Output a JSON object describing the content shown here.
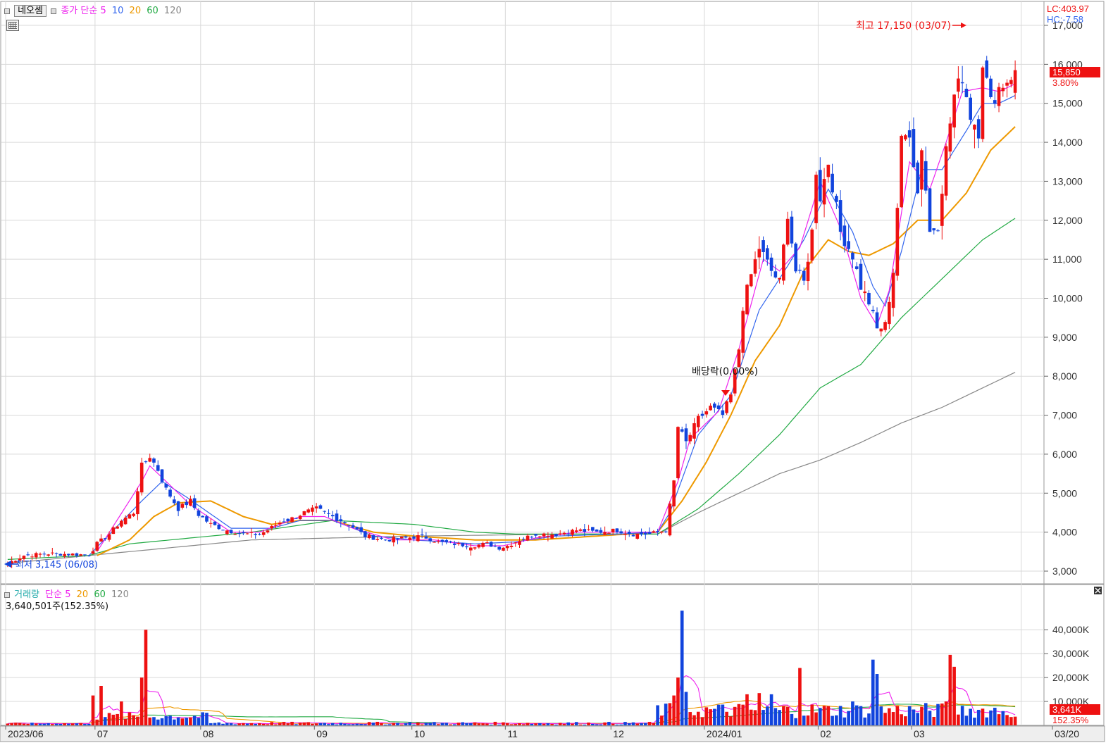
{
  "price_header": {
    "symbol": "네오셈",
    "type_label": "종가 단순",
    "ma_periods": [
      "5",
      "10",
      "20",
      "60",
      "120"
    ],
    "lc": "LC:403.97",
    "hc": "HC:-7.58"
  },
  "volume_header": {
    "label": "거래량",
    "type_label": "단순",
    "ma_periods": [
      "5",
      "20",
      "60",
      "120"
    ],
    "current": "3,640,501주(152.35%)"
  },
  "annotations": {
    "high": "최고 17,150 (03/07)",
    "low": "최저 3,145 (06/08)",
    "dividend": "배당락(0.00%)"
  },
  "last_price": {
    "value": "15,850",
    "change": "3.80%"
  },
  "last_volume": {
    "value": "3,641K",
    "ratio": "152.35%"
  },
  "colors": {
    "up": "#ee1111",
    "down": "#1144dd",
    "ma5": "#ee22ee",
    "ma10": "#3366ee",
    "ma20": "#ee9900",
    "ma60": "#22aa44",
    "ma120": "#888888",
    "grid": "#d9d9d9"
  },
  "chart_data": [
    {
      "type": "candlestick",
      "title": "네오셈",
      "y_ticks": [
        "3,000",
        "4,000",
        "5,000",
        "6,000",
        "7,000",
        "8,000",
        "9,000",
        "10,000",
        "11,000",
        "12,000",
        "13,000",
        "14,000",
        "15,000",
        "16,000",
        "17,000"
      ],
      "ylim": [
        2700,
        17400
      ],
      "x_ticks": [
        "2023/06",
        "07",
        "08",
        "09",
        "10",
        "11",
        "12",
        "2024/01",
        "02",
        "03",
        "03/20"
      ],
      "x_tick_bar_index": [
        0,
        22,
        48,
        76,
        100,
        123,
        149,
        172,
        200,
        223,
        250
      ],
      "anchors": [
        [
          0,
          3200
        ],
        [
          4,
          3400
        ],
        [
          10,
          3450
        ],
        [
          20,
          3420
        ],
        [
          22,
          3700
        ],
        [
          25,
          3950
        ],
        [
          28,
          4300
        ],
        [
          31,
          4500
        ],
        [
          33,
          5700
        ],
        [
          35,
          5950
        ],
        [
          37,
          5600
        ],
        [
          39,
          5100
        ],
        [
          42,
          4600
        ],
        [
          45,
          4800
        ],
        [
          47,
          4450
        ],
        [
          50,
          4200
        ],
        [
          54,
          4050
        ],
        [
          58,
          3950
        ],
        [
          62,
          3950
        ],
        [
          64,
          4050
        ],
        [
          67,
          4250
        ],
        [
          70,
          4350
        ],
        [
          73,
          4500
        ],
        [
          76,
          4600
        ],
        [
          80,
          4400
        ],
        [
          84,
          4200
        ],
        [
          88,
          3900
        ],
        [
          93,
          3800
        ],
        [
          98,
          3850
        ],
        [
          102,
          3900
        ],
        [
          106,
          3750
        ],
        [
          110,
          3700
        ],
        [
          114,
          3650
        ],
        [
          118,
          3700
        ],
        [
          121,
          3600
        ],
        [
          123,
          3650
        ],
        [
          126,
          3800
        ],
        [
          130,
          3950
        ],
        [
          135,
          3950
        ],
        [
          140,
          4050
        ],
        [
          145,
          4000
        ],
        [
          150,
          4050
        ],
        [
          154,
          3950
        ],
        [
          158,
          3950
        ],
        [
          162,
          4050
        ],
        [
          164,
          5300
        ],
        [
          165,
          6700
        ],
        [
          167,
          6300
        ],
        [
          170,
          6900
        ],
        [
          173,
          7200
        ],
        [
          176,
          7000
        ],
        [
          178,
          7500
        ],
        [
          180,
          8700
        ],
        [
          181,
          9800
        ],
        [
          183,
          10600
        ],
        [
          185,
          11300
        ],
        [
          188,
          10700
        ],
        [
          190,
          10400
        ],
        [
          192,
          12200
        ],
        [
          194,
          10700
        ],
        [
          196,
          10400
        ],
        [
          198,
          11700
        ],
        [
          199,
          13300
        ],
        [
          200,
          12600
        ],
        [
          202,
          13500
        ],
        [
          205,
          11700
        ],
        [
          208,
          11100
        ],
        [
          210,
          10300
        ],
        [
          212,
          9900
        ],
        [
          214,
          9200
        ],
        [
          216,
          9300
        ],
        [
          218,
          10700
        ],
        [
          220,
          14000
        ],
        [
          222,
          14300
        ],
        [
          224,
          12700
        ],
        [
          225,
          13900
        ],
        [
          227,
          11700
        ],
        [
          229,
          11900
        ],
        [
          231,
          13800
        ],
        [
          233,
          15200
        ],
        [
          235,
          15700
        ],
        [
          237,
          14700
        ],
        [
          239,
          14300
        ],
        [
          240,
          16100
        ],
        [
          242,
          15000
        ],
        [
          244,
          15400
        ],
        [
          246,
          15600
        ],
        [
          248,
          15850
        ]
      ],
      "open": 15270,
      "high": 16100,
      "low": 15100,
      "close": 15850,
      "ma_lines": {
        "ma5": [
          [
            22,
            3500
          ],
          [
            33,
            5300
          ],
          [
            35,
            5700
          ],
          [
            39,
            5300
          ],
          [
            45,
            4700
          ],
          [
            55,
            4000
          ],
          [
            62,
            4000
          ],
          [
            67,
            4200
          ],
          [
            72,
            4400
          ],
          [
            78,
            4400
          ],
          [
            85,
            4100
          ],
          [
            95,
            3800
          ],
          [
            105,
            3800
          ],
          [
            115,
            3650
          ],
          [
            122,
            3650
          ],
          [
            130,
            3850
          ],
          [
            140,
            4000
          ],
          [
            150,
            4000
          ],
          [
            160,
            4000
          ],
          [
            165,
            5300
          ],
          [
            168,
            6400
          ],
          [
            175,
            7100
          ],
          [
            180,
            8700
          ],
          [
            186,
            11000
          ],
          [
            190,
            10700
          ],
          [
            195,
            11300
          ],
          [
            200,
            13000
          ],
          [
            205,
            11800
          ],
          [
            210,
            10000
          ],
          [
            214,
            9300
          ],
          [
            217,
            10200
          ],
          [
            222,
            13500
          ],
          [
            227,
            12800
          ],
          [
            231,
            14000
          ],
          [
            235,
            15300
          ],
          [
            240,
            15400
          ],
          [
            244,
            15300
          ],
          [
            248,
            15500
          ]
        ],
        "ma10": [
          [
            20,
            3400
          ],
          [
            33,
            4800
          ],
          [
            38,
            5300
          ],
          [
            44,
            4900
          ],
          [
            55,
            4100
          ],
          [
            65,
            4100
          ],
          [
            72,
            4300
          ],
          [
            80,
            4300
          ],
          [
            90,
            3900
          ],
          [
            100,
            3800
          ],
          [
            115,
            3700
          ],
          [
            125,
            3750
          ],
          [
            135,
            3900
          ],
          [
            150,
            3950
          ],
          [
            160,
            4000
          ],
          [
            163,
            4500
          ],
          [
            170,
            6500
          ],
          [
            178,
            7500
          ],
          [
            185,
            9700
          ],
          [
            190,
            10500
          ],
          [
            196,
            11500
          ],
          [
            202,
            12800
          ],
          [
            208,
            11700
          ],
          [
            213,
            10300
          ],
          [
            216,
            9800
          ],
          [
            220,
            11200
          ],
          [
            225,
            13300
          ],
          [
            230,
            13300
          ],
          [
            236,
            14300
          ],
          [
            240,
            15000
          ],
          [
            244,
            15000
          ],
          [
            248,
            15200
          ]
        ],
        "ma20": [
          [
            22,
            3400
          ],
          [
            30,
            3800
          ],
          [
            36,
            4400
          ],
          [
            42,
            4750
          ],
          [
            50,
            4800
          ],
          [
            58,
            4400
          ],
          [
            65,
            4200
          ],
          [
            72,
            4300
          ],
          [
            80,
            4300
          ],
          [
            90,
            4000
          ],
          [
            100,
            3900
          ],
          [
            115,
            3800
          ],
          [
            130,
            3800
          ],
          [
            145,
            3900
          ],
          [
            160,
            4000
          ],
          [
            166,
            4800
          ],
          [
            172,
            5800
          ],
          [
            178,
            7000
          ],
          [
            184,
            8400
          ],
          [
            190,
            9300
          ],
          [
            196,
            10700
          ],
          [
            202,
            11500
          ],
          [
            207,
            11200
          ],
          [
            212,
            11100
          ],
          [
            218,
            11400
          ],
          [
            224,
            12000
          ],
          [
            230,
            12000
          ],
          [
            236,
            12700
          ],
          [
            242,
            13800
          ],
          [
            248,
            14400
          ]
        ],
        "ma60": [
          [
            0,
            3300
          ],
          [
            20,
            3400
          ],
          [
            30,
            3700
          ],
          [
            45,
            3850
          ],
          [
            60,
            4000
          ],
          [
            80,
            4300
          ],
          [
            100,
            4200
          ],
          [
            115,
            4000
          ],
          [
            125,
            3950
          ],
          [
            140,
            3950
          ],
          [
            160,
            3950
          ],
          [
            170,
            4600
          ],
          [
            180,
            5500
          ],
          [
            190,
            6500
          ],
          [
            200,
            7700
          ],
          [
            210,
            8300
          ],
          [
            220,
            9500
          ],
          [
            230,
            10500
          ],
          [
            240,
            11500
          ],
          [
            248,
            12050
          ]
        ],
        "ma120": [
          [
            0,
            3200
          ],
          [
            30,
            3500
          ],
          [
            60,
            3800
          ],
          [
            100,
            3900
          ],
          [
            140,
            3950
          ],
          [
            160,
            3950
          ],
          [
            170,
            4500
          ],
          [
            180,
            5000
          ],
          [
            190,
            5500
          ],
          [
            200,
            5850
          ],
          [
            210,
            6300
          ],
          [
            220,
            6800
          ],
          [
            230,
            7200
          ],
          [
            240,
            7700
          ],
          [
            248,
            8100
          ]
        ]
      }
    },
    {
      "type": "bar",
      "title": "거래량",
      "y_ticks": [
        "10,000K",
        "20,000K",
        "30,000K",
        "40,000K"
      ],
      "ylim": [
        0,
        49500
      ],
      "spikes": {
        "21": 12500,
        "23": 16500,
        "28": 10000,
        "33": 20000,
        "34": 40000,
        "164": 12500,
        "165": 20000,
        "166": 48000,
        "167": 14000,
        "182": 13000,
        "185": 13500,
        "188": 13000,
        "195": 24000,
        "208": 10000,
        "213": 27500,
        "214": 21500,
        "231": 10000,
        "232": 29500,
        "233": 24500
      }
    }
  ]
}
